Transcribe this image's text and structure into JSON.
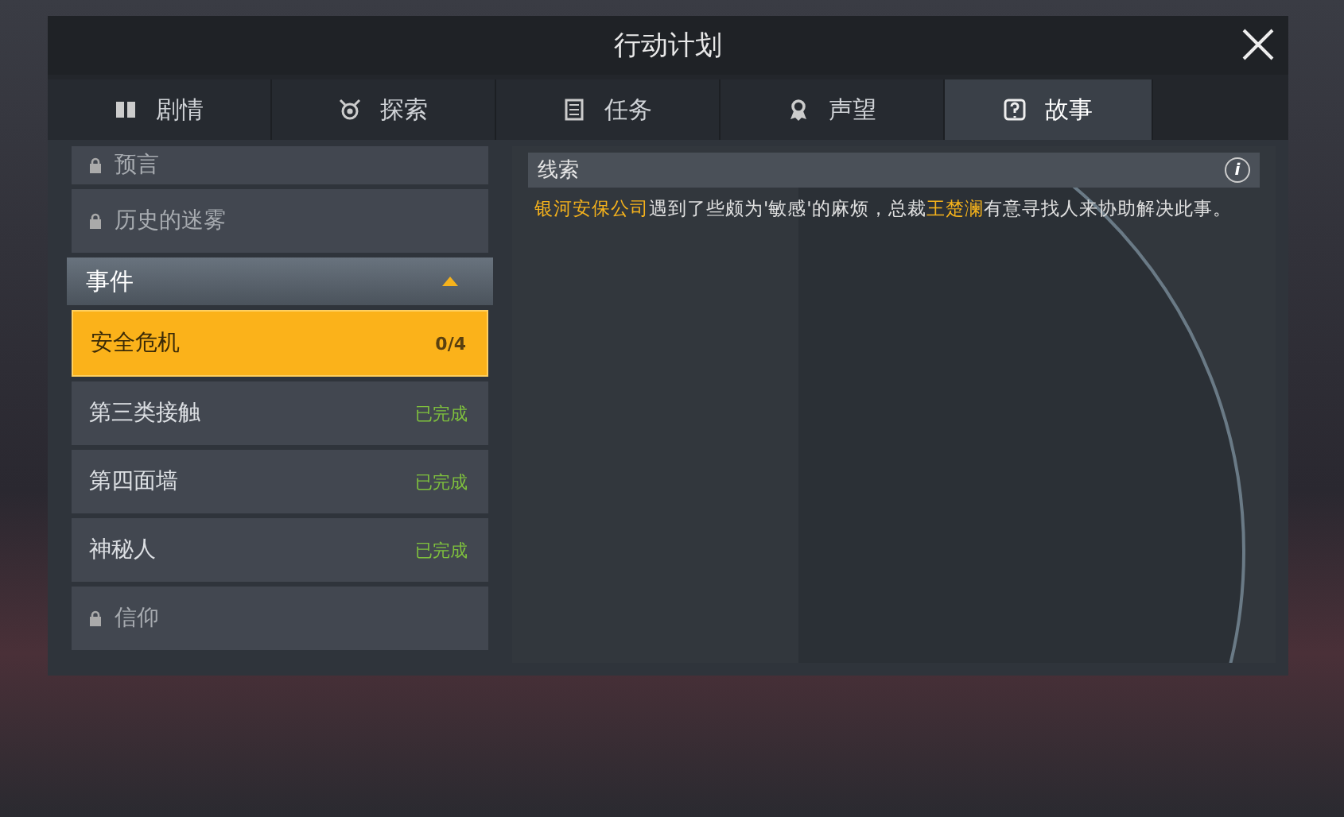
{
  "window": {
    "title": "行动计划"
  },
  "tabs": [
    {
      "label": "剧情",
      "selected": false
    },
    {
      "label": "探索",
      "selected": false
    },
    {
      "label": "任务",
      "selected": false
    },
    {
      "label": "声望",
      "selected": false
    },
    {
      "label": "故事",
      "selected": true
    }
  ],
  "sidebar": {
    "locked_items": [
      {
        "label": "预言",
        "locked": true
      },
      {
        "label": "历史的迷雾",
        "locked": true
      }
    ],
    "group": {
      "label": "事件",
      "expanded": true
    },
    "items": [
      {
        "label": "安全危机",
        "status": "0/4",
        "selected": true,
        "locked": false,
        "completed": false
      },
      {
        "label": "第三类接触",
        "status": "已完成",
        "selected": false,
        "locked": false,
        "completed": true
      },
      {
        "label": "第四面墙",
        "status": "已完成",
        "selected": false,
        "locked": false,
        "completed": true
      },
      {
        "label": "神秘人",
        "status": "已完成",
        "selected": false,
        "locked": false,
        "completed": true
      },
      {
        "label": "信仰",
        "selected": false,
        "locked": true
      }
    ]
  },
  "clue": {
    "title": "线索",
    "info_icon": "i",
    "text": [
      {
        "text": "银河安保公司",
        "highlight": true
      },
      {
        "text": "遇到了些颇为'敏感'的麻烦，总裁",
        "highlight": false
      },
      {
        "text": "王楚澜",
        "highlight": true
      },
      {
        "text": "有意寻找人来协助解决此事。",
        "highlight": false
      }
    ]
  }
}
